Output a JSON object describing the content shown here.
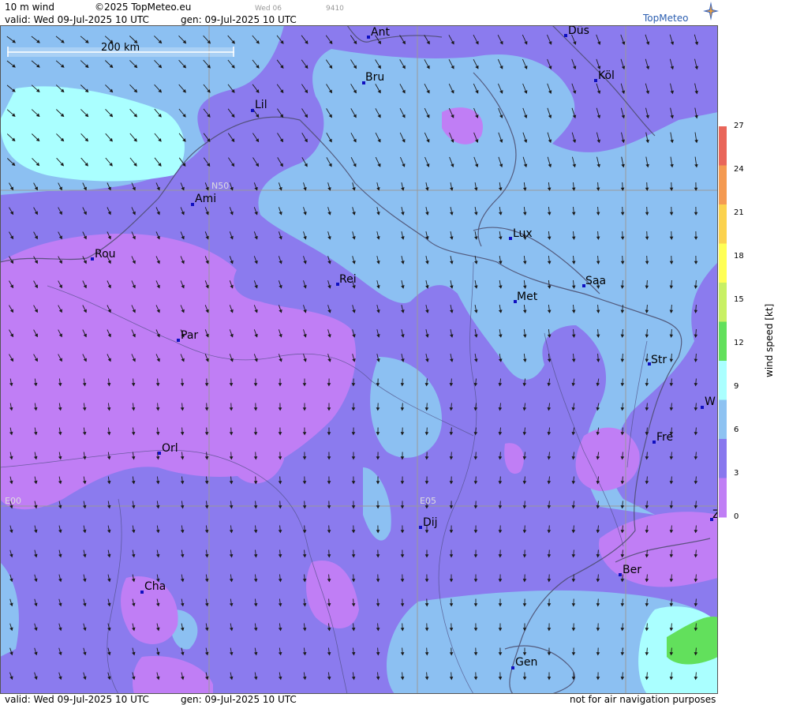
{
  "header": {
    "product": "10 m wind",
    "copyright": "©2025 TopMeteo.eu",
    "day_mark": "Wed 06",
    "code": "9410",
    "valid": "valid:  Wed  09-Jul-2025  10 UTC",
    "gen": "gen: 09-Jul-2025 10 UTC",
    "brand": "TopMeteo"
  },
  "map": {
    "scale_label": "200 km",
    "grid_labels": [
      {
        "text": "N50"
      },
      {
        "text": "E00"
      },
      {
        "text": "E05"
      }
    ],
    "cities": [
      {
        "name": "Ant"
      },
      {
        "name": "Düs"
      },
      {
        "name": "Bru"
      },
      {
        "name": "Köl"
      },
      {
        "name": "Lil"
      },
      {
        "name": "Ami"
      },
      {
        "name": "Rou"
      },
      {
        "name": "Lux"
      },
      {
        "name": "Rei"
      },
      {
        "name": "Saa"
      },
      {
        "name": "Met"
      },
      {
        "name": "Par"
      },
      {
        "name": "Str"
      },
      {
        "name": "W"
      },
      {
        "name": "Fre"
      },
      {
        "name": "Orl"
      },
      {
        "name": "Dij"
      },
      {
        "name": "Z"
      },
      {
        "name": "Ber"
      },
      {
        "name": "Cha"
      },
      {
        "name": "Gen"
      }
    ]
  },
  "legend": {
    "title": "wind speed [kt]",
    "ticks": [
      "27",
      "24",
      "21",
      "18",
      "15",
      "12",
      "9",
      "6",
      "3",
      "0"
    ],
    "colors": [
      "#e9665a",
      "#f49a52",
      "#fbd24e",
      "#ffff55",
      "#c8f064",
      "#62e05c",
      "#aaffff",
      "#8ec2f2",
      "#8877ee",
      "#c07ef5"
    ]
  },
  "footer": {
    "valid": "valid:  Wed  09-Jul-2025  10 UTC",
    "gen": "gen: 09-Jul-2025 10 UTC",
    "disclaimer": "not for air navigation purposes"
  }
}
